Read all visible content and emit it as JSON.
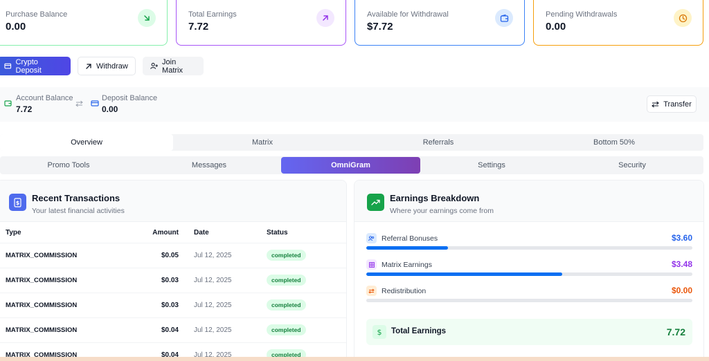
{
  "stats": [
    {
      "label": "Purchase Balance",
      "value": "0.00",
      "icon": "arrow-down-right-icon",
      "color": "#16a34a",
      "bg": "#dcfce7"
    },
    {
      "label": "Total Earnings",
      "value": "7.72",
      "icon": "arrow-up-right-icon",
      "color": "#9333ea",
      "bg": "#f3e8ff"
    },
    {
      "label": "Available for Withdrawal",
      "value": "$7.72",
      "icon": "wallet-icon",
      "color": "#2563eb",
      "bg": "#dbeafe"
    },
    {
      "label": "Pending Withdrawals",
      "value": "0.00",
      "icon": "clock-icon",
      "color": "#d97706",
      "bg": "#fef3c7"
    }
  ],
  "actions": {
    "crypto_deposit": "Crypto Deposit",
    "withdraw": "Withdraw",
    "join_matrix": "Join Matrix"
  },
  "balances": {
    "account_label": "Account Balance",
    "account_value": "7.72",
    "deposit_label": "Deposit Balance",
    "deposit_value": "0.00",
    "transfer": "Transfer"
  },
  "tabs_row1": [
    "Overview",
    "Matrix",
    "Referrals",
    "Bottom 50%"
  ],
  "tabs_row2": [
    "Promo Tools",
    "Messages",
    "OmniGram",
    "Settings",
    "Security"
  ],
  "transactions": {
    "title": "Recent Transactions",
    "subtitle": "Your latest financial activities",
    "columns": {
      "type": "Type",
      "amount": "Amount",
      "date": "Date",
      "status": "Status"
    },
    "rows": [
      {
        "type": "MATRIX_COMMISSION",
        "amount": "$0.05",
        "date": "Jul 12, 2025",
        "status": "completed"
      },
      {
        "type": "MATRIX_COMMISSION",
        "amount": "$0.03",
        "date": "Jul 12, 2025",
        "status": "completed"
      },
      {
        "type": "MATRIX_COMMISSION",
        "amount": "$0.03",
        "date": "Jul 12, 2025",
        "status": "completed"
      },
      {
        "type": "MATRIX_COMMISSION",
        "amount": "$0.04",
        "date": "Jul 12, 2025",
        "status": "completed"
      },
      {
        "type": "MATRIX_COMMISSION",
        "amount": "$0.04",
        "date": "Jul 12, 2025",
        "status": "completed"
      }
    ]
  },
  "earnings": {
    "title": "Earnings Breakdown",
    "subtitle": "Where your earnings come from",
    "items": [
      {
        "name": "Referral Bonuses",
        "value": "$3.60",
        "color": "#2563eb",
        "progress": 0.25
      },
      {
        "name": "Matrix Earnings",
        "value": "$3.48",
        "color": "#9333ea",
        "progress": 0.6
      },
      {
        "name": "Redistribution",
        "value": "$0.00",
        "color": "#ea580c",
        "progress": 0
      }
    ],
    "total_label": "Total Earnings",
    "total_value": "7.72"
  }
}
